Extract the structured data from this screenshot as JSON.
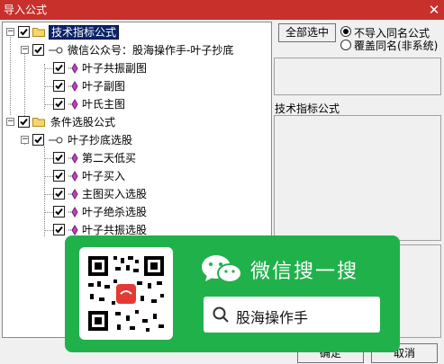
{
  "window": {
    "title": "导入公式",
    "close_glyph": "✕"
  },
  "tree": {
    "nodes": [
      {
        "label": "技术指标公式",
        "selected": true
      },
      {
        "label": "微信公众号：股海操作手-叶子抄底"
      },
      {
        "label": "叶子共振副图"
      },
      {
        "label": "叶子副图"
      },
      {
        "label": "叶氏主图"
      },
      {
        "label": "条件选股公式"
      },
      {
        "label": "叶子抄底选股"
      },
      {
        "label": "第二天低买"
      },
      {
        "label": "叶子买入"
      },
      {
        "label": "主图买入选股"
      },
      {
        "label": "叶子绝杀选股"
      },
      {
        "label": "叶子共振选股"
      }
    ]
  },
  "right": {
    "select_all_label": "全部选中",
    "radio_options": [
      {
        "label": "不导入同名公式",
        "checked": true
      },
      {
        "label": "覆盖同名(非系统)",
        "checked": false
      }
    ],
    "section_label": "技术指标公式"
  },
  "footer": {
    "ok_label": "确定",
    "cancel_label": "取消"
  },
  "wechat_overlay": {
    "heading": "微信搜一搜",
    "search_text": "股海操作手",
    "brand_color": "#21b14b"
  }
}
